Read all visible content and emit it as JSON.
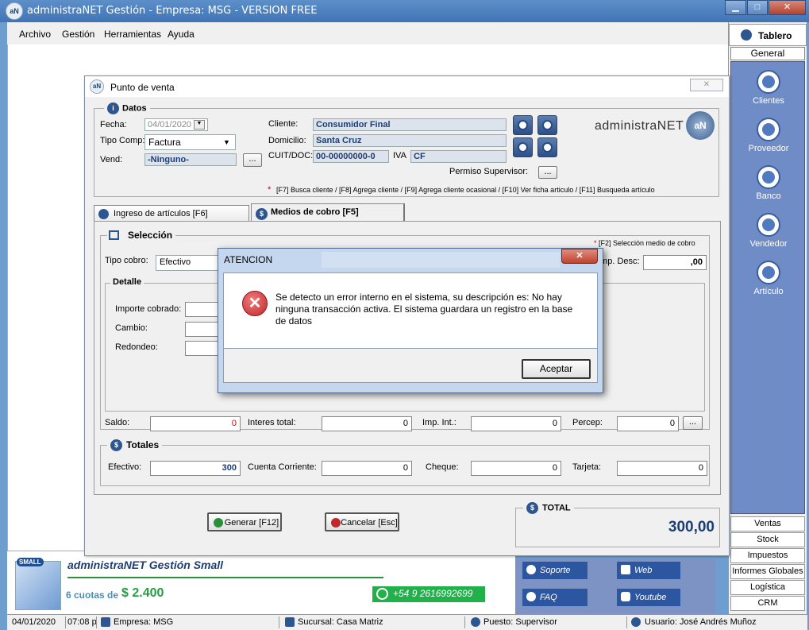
{
  "window": {
    "title": "administraNET Gestión - Empresa: MSG - VERSION FREE",
    "icon_text": "aN",
    "min": "▁",
    "max": "□",
    "close": "✕"
  },
  "menu": {
    "items": [
      "Archivo",
      "Gestión",
      "Herramientas",
      "Ayuda"
    ]
  },
  "side": {
    "tablero": "Tablero",
    "general": "General",
    "nav": [
      "Clientes",
      "Proveedor",
      "Banco",
      "Vendedor",
      "Artículo"
    ],
    "sections": [
      "Ventas",
      "Stock",
      "Impuestos",
      "Informes Globales",
      "Logística",
      "CRM"
    ]
  },
  "pos": {
    "title": "Punto de venta",
    "close": "✕",
    "datos": {
      "title": "Datos",
      "fecha_label": "Fecha:",
      "fecha": "04/01/2020",
      "tipo_label": "Tipo Comp:",
      "tipo": "Factura",
      "vend_label": "Vend:",
      "vend": "-Ninguno-",
      "dots": "...",
      "cliente_label": "Cliente:",
      "cliente": "Consumidor Final",
      "domicilio_label": "Domicilio:",
      "domicilio": "Santa Cruz",
      "cuit_label": "CUIT/DOC:",
      "cuit": "00-00000000-0",
      "iva_label": "IVA",
      "iva": "CF",
      "permiso_label": "Permiso Supervisor:",
      "shortcuts": "[F7] Busca cliente / [F8] Agrega cliente / [F9] Agrega cliente ocasional / [F10] Ver ficha articulo / [F11] Busqueda artículo",
      "star": "*",
      "logo": "administraNET",
      "logo_badge": "aN"
    },
    "tabs": [
      "Ingreso de artículos [F6]",
      "Medios de cobro [F5]"
    ],
    "seleccion": {
      "title": "Selección",
      "hint": "[F2] Selección medio de cobro",
      "tipo_label": "Tipo cobro:",
      "tipo": "Efectivo",
      "imp_label": "Imp. Desc:",
      "imp": ",00"
    },
    "detalle": {
      "title": "Detalle",
      "importe": "Importe cobrado:",
      "cambio": "Cambio:",
      "redondeo": "Redondeo:"
    },
    "fila": [
      {
        "label": "Saldo:",
        "value": "0"
      },
      {
        "label": "Interes total:",
        "value": "0"
      },
      {
        "label": "Imp. Int.:",
        "value": "0"
      },
      {
        "label": "Percep:",
        "value": "0"
      }
    ],
    "totales": {
      "title": "Totales",
      "items": [
        {
          "label": "Efectivo:",
          "value": "300"
        },
        {
          "label": "Cuenta Corriente:",
          "value": "0"
        },
        {
          "label": "Cheque:",
          "value": "0"
        },
        {
          "label": "Tarjeta:",
          "value": "0"
        }
      ]
    },
    "generar": "Generar [F12]",
    "cancelar": "Cancelar [Esc]",
    "total_label": "TOTAL",
    "total": "300,00"
  },
  "alert": {
    "title": "ATENCION",
    "close": "✕",
    "message": "Se detecto un error interno en el sistema, su descripción es: No hay ninguna transacción activa. El sistema guardara un registro en la base de datos",
    "accept": "Aceptar"
  },
  "promo": {
    "badge": "SMALL",
    "product": "administraNET Gestión Small",
    "cuotas": "6 cuotas de",
    "price": "$ 2.400",
    "phone": "+54 9 2616992699"
  },
  "links": [
    "Soporte",
    "Web",
    "FAQ",
    "Youtube"
  ],
  "status": {
    "date": "04/01/2020",
    "time": "07:08 p",
    "empresa": "Empresa: MSG",
    "sucursal": "Sucursal: Casa Matriz",
    "puesto": "Puesto: Supervisor",
    "usuario": "Usuario: José Andrés Muñoz"
  },
  "colors": {
    "accent": "#2d5691",
    "error": "#c0282d",
    "green": "#22b04b"
  }
}
